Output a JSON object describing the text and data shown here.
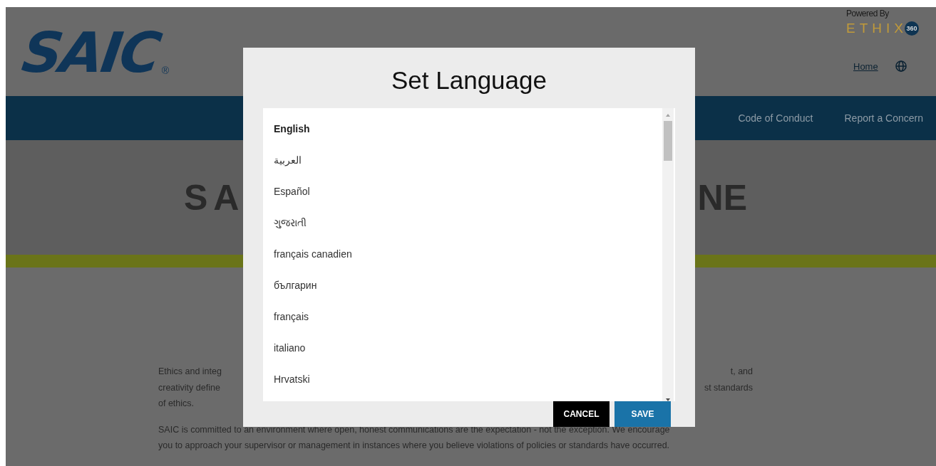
{
  "header": {
    "logo": "SAIC",
    "logo_mark": "®",
    "powered_by": "Powered By",
    "brand": "ETHIX",
    "brand_badge": "360",
    "links": [
      {
        "label": "Home"
      }
    ]
  },
  "nav": {
    "items": [
      {
        "label": "Code of Conduct"
      },
      {
        "label": "Report a Concern"
      }
    ]
  },
  "hero": {
    "title_parts": [
      "SA",
      "NE"
    ]
  },
  "intro": {
    "paragraph_1_lines": [
      {
        "left": "Ethics and integ",
        "right": "t, and"
      },
      {
        "left": "creativity define",
        "right": "st standards"
      },
      {
        "left": "of ethics."
      }
    ],
    "paragraph_2_lines": [
      "SAIC is committed to an environment where open, honest communications are the expectation - not the exception. We encourage",
      "you to approach your supervisor or management in instances where you believe violations of policies or standards have occurred."
    ]
  },
  "dialog": {
    "title": "Set Language",
    "languages": [
      {
        "label": "English",
        "selected": true
      },
      {
        "label": "العربية",
        "selected": false
      },
      {
        "label": "Español",
        "selected": false
      },
      {
        "label": "ગુજરાતી",
        "selected": false
      },
      {
        "label": "français canadien",
        "selected": false
      },
      {
        "label": "българин",
        "selected": false
      },
      {
        "label": "français",
        "selected": false
      },
      {
        "label": "italiano",
        "selected": false
      },
      {
        "label": "Hrvatski",
        "selected": false
      }
    ],
    "buttons": [
      {
        "label": "CANCEL",
        "kind": "secondary"
      },
      {
        "label": "SAVE",
        "kind": "primary"
      }
    ]
  }
}
